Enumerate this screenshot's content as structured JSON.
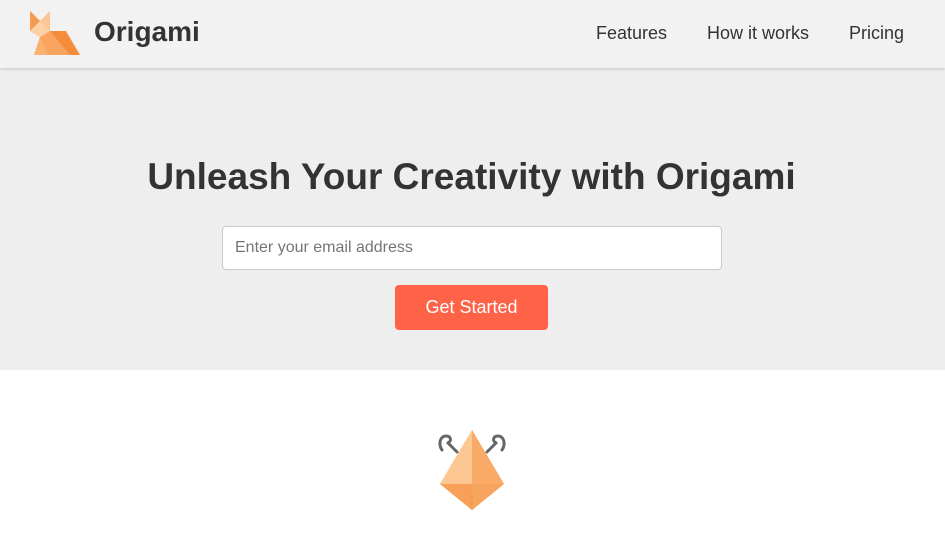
{
  "header": {
    "brand": "Origami",
    "logo_icon": "origami-fox-icon",
    "nav": [
      {
        "label": "Features"
      },
      {
        "label": "How it works"
      },
      {
        "label": "Pricing"
      }
    ]
  },
  "hero": {
    "title": "Unleash Your Creativity with Origami",
    "email_placeholder": "Enter your email address",
    "email_value": "",
    "cta_label": "Get Started"
  },
  "feature": {
    "illustration_icon": "origami-crane-icon"
  },
  "colors": {
    "accent": "#ff6347",
    "logo_orange": "#f9a15a",
    "hero_background": "#eeeeee",
    "header_background": "#f2f2f2",
    "text": "#333333"
  }
}
